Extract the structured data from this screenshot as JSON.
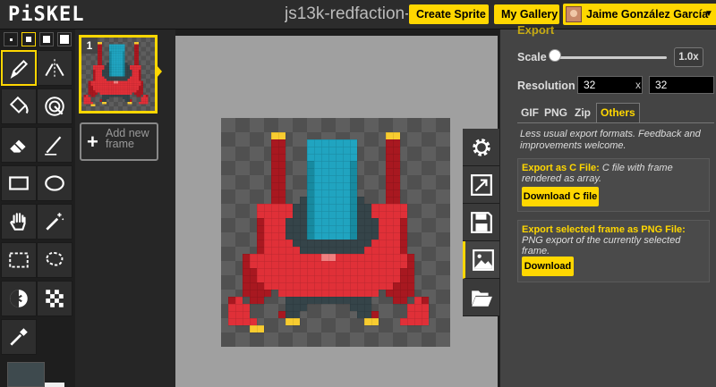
{
  "header": {
    "logo": "PiSKEL",
    "sprite_name": "js13k-redfaction-",
    "create_sprite": "Create Sprite",
    "my_gallery": "My Gallery",
    "user_name": "Jaime González García",
    "user_caret": "▼"
  },
  "tools": {
    "pen_sizes": [
      1,
      2,
      3,
      4
    ],
    "selected_pen_size": 2,
    "items": [
      {
        "name": "pen-tool",
        "icon": "pencil-icon"
      },
      {
        "name": "mirror-pen-tool",
        "icon": "mirror-pen-icon"
      },
      {
        "name": "paint-bucket-tool",
        "icon": "paint-bucket-icon"
      },
      {
        "name": "paint-same-color-tool",
        "icon": "magic-bucket-icon"
      },
      {
        "name": "eraser-tool",
        "icon": "eraser-icon"
      },
      {
        "name": "stroke-tool",
        "icon": "stroke-icon"
      },
      {
        "name": "rectangle-tool",
        "icon": "rectangle-icon"
      },
      {
        "name": "circle-tool",
        "icon": "circle-icon"
      },
      {
        "name": "move-tool",
        "icon": "hand-icon"
      },
      {
        "name": "shape-selection-tool",
        "icon": "magic-wand-icon"
      },
      {
        "name": "rectangle-selection-tool",
        "icon": "rectangle-select-icon"
      },
      {
        "name": "lasso-selection-tool",
        "icon": "lasso-icon"
      },
      {
        "name": "lighten-tool",
        "icon": "lighten-icon"
      },
      {
        "name": "dithering-tool",
        "icon": "dithering-icon"
      },
      {
        "name": "color-picker-tool",
        "icon": "eyedropper-icon"
      }
    ],
    "primary_color": "#3e4a4e",
    "secondary_color": "#eeeeee"
  },
  "frames": {
    "items": [
      {
        "number": "1"
      }
    ],
    "add_label": "Add new frame",
    "add_plus": "+"
  },
  "settings": {
    "section_title": "Export",
    "scale_label": "Scale",
    "scale_value": "1.0x",
    "scale_fraction": 0.0,
    "resolution_label": "Resolution",
    "resolution_width": "32",
    "resolution_x": "x",
    "resolution_height": "32",
    "tabs": [
      "GIF",
      "PNG",
      "Zip",
      "Others"
    ],
    "selected_tab": "Others",
    "others_description": "Less usual export formats. Feedback and improvements welcome.",
    "c_file_title": "Export as C File:",
    "c_file_text": "C file with frame rendered as array.",
    "c_file_button": "Download C file",
    "png_frame_title": "Export selected frame as PNG File:",
    "png_frame_text": "PNG export of the currently selected frame.",
    "png_frame_button": "Download"
  },
  "side_tabs": [
    {
      "name": "settings-tab",
      "icon": "gear-icon"
    },
    {
      "name": "resize-tab",
      "icon": "resize-icon"
    },
    {
      "name": "save-tab",
      "icon": "floppy-disk-icon"
    },
    {
      "name": "export-tab",
      "icon": "image-icon",
      "selected": true
    },
    {
      "name": "import-tab",
      "icon": "folder-open-icon"
    }
  ],
  "colors": {
    "accent": "#ffd700",
    "transparent_light": "#5e5e5e",
    "transparent_dark": "#505050",
    "ship_palette": {
      "T": "#20a4c0",
      "t": "#178aa0",
      "D": "#354449",
      "R": "#e03038",
      "r": "#a81820",
      "Y": "#f8cc30",
      "P": "#f08080"
    }
  }
}
